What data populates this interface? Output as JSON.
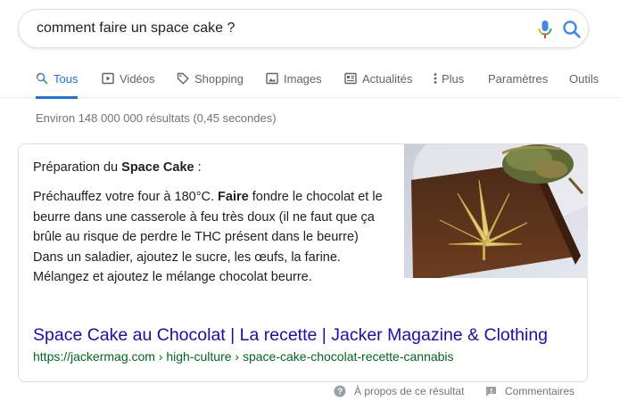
{
  "search": {
    "query": "comment faire un space cake ?"
  },
  "tabs": [
    {
      "label": "Tous",
      "icon": "search-icon",
      "active": true
    },
    {
      "label": "Vidéos",
      "icon": "video-icon"
    },
    {
      "label": "Shopping",
      "icon": "tag-icon"
    },
    {
      "label": "Images",
      "icon": "image-icon"
    },
    {
      "label": "Actualités",
      "icon": "news-icon"
    },
    {
      "label": "Plus",
      "icon": "more-vert-icon"
    },
    {
      "label": "Paramètres"
    },
    {
      "label": "Outils"
    }
  ],
  "stats": "Environ 148 000 000 résultats (0,45 secondes)",
  "snippet": {
    "title_prefix": "Préparation du ",
    "title_bold": "Space Cake",
    "title_suffix": " :",
    "text_before": "Préchauffez votre four à 180°C. ",
    "text_bold": "Faire",
    "text_after": " fondre le chocolat et le beurre dans une casserole à feu très doux (il ne faut que ça brûle au risque de perdre le THC présent dans le beurre) Dans un saladier, ajoutez le sucre, les œufs, la farine. Mélangez et ajoutez le mélange chocolat beurre.",
    "link_text": "Space Cake au Chocolat | La recette | Jacker Magazine & Clothing",
    "url": "https://jackermag.com › high-culture › space-cake-chocolat-recette-cannabis",
    "image": "space-cake-slice-photo"
  },
  "footer": {
    "about": "À propos de ce résultat",
    "feedback": "Commentaires"
  },
  "colors": {
    "link": "#1a0dab",
    "url": "#006621",
    "active_tab": "#1a73e8",
    "muted": "#70757a"
  }
}
